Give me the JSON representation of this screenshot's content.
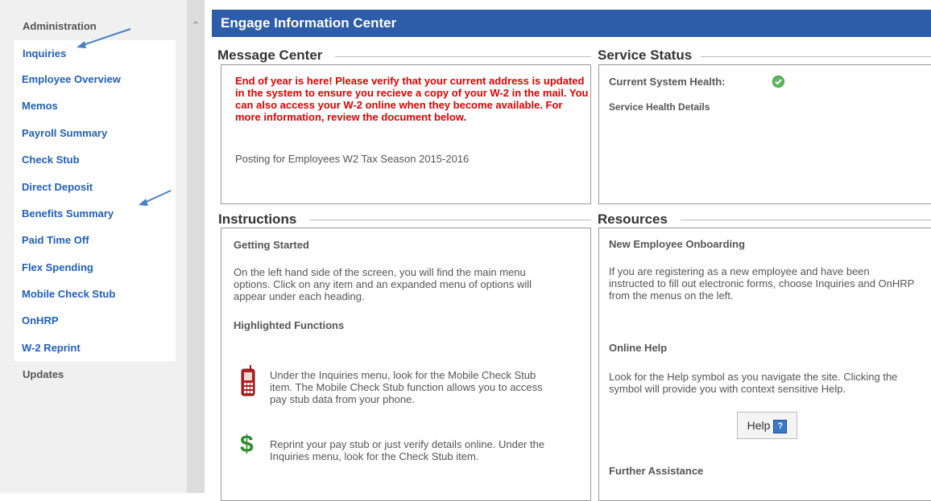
{
  "sidebar": {
    "administration": "Administration",
    "inquiries_title": "Inquiries",
    "items": [
      {
        "label": "Employee Overview"
      },
      {
        "label": "Memos"
      },
      {
        "label": "Payroll Summary"
      },
      {
        "label": "Check Stub"
      },
      {
        "label": "Direct Deposit"
      },
      {
        "label": "Benefits Summary"
      },
      {
        "label": "Paid Time Off"
      },
      {
        "label": "Flex Spending"
      },
      {
        "label": "Mobile Check Stub"
      },
      {
        "label": "OnHRP"
      },
      {
        "label": "W-2 Reprint"
      }
    ],
    "updates": "Updates"
  },
  "banner": {
    "title": "Engage Information Center"
  },
  "message_center": {
    "title": "Message Center",
    "alert": "End of year is here!  Please verify that your current address is updated in the system to ensure you recieve a copy of your W-2 in the mail.  You can also access your W-2 online when they become available.  For more information, review the document below.",
    "link": "Posting for Employees W2 Tax Season 2015-2016"
  },
  "service_status": {
    "title": "Service Status",
    "health_label": "Current System Health:",
    "details_link": "Service Health Details"
  },
  "instructions": {
    "title": "Instructions",
    "getting_started": "Getting Started",
    "getting_started_text": "On the left hand side of the screen, you will find the main menu options.  Click on any item and an expanded menu of options will appear under each heading.",
    "highlighted": "Highlighted Functions",
    "mobile_text": "Under the Inquiries menu, look for the Mobile Check Stub item.  The Mobile Check Stub function allows you to access pay stub data from your phone.",
    "reprint_text": "Reprint your pay stub or just verify details online.  Under the Inquiries menu, look for the Check Stub item."
  },
  "resources": {
    "title": "Resources",
    "onboarding": "New Employee Onboarding",
    "onboarding_text": "If you are registering as a new employee and have been instructed to fill out electronic forms, choose Inquiries and OnHRP from the menus on the left.",
    "online_help": "Online Help",
    "online_help_text": "Look for the Help symbol as you navigate the site.  Clicking the symbol will provide you with context sensitive Help.",
    "help_button": "Help",
    "help_icon_glyph": "?",
    "further": "Further Assistance"
  },
  "icons": {
    "status_ok_color": "#5cb85c",
    "dollar_glyph": "$"
  }
}
